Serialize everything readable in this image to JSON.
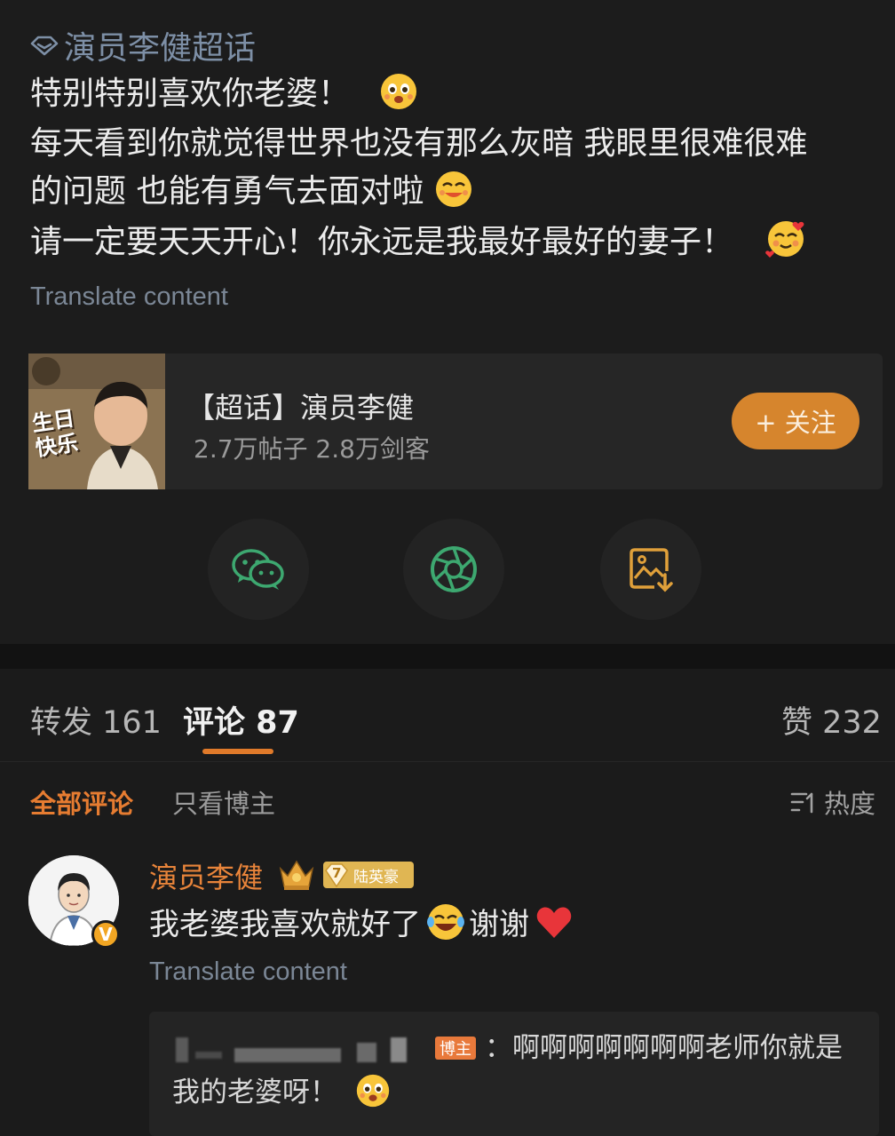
{
  "post": {
    "topic_tag": "演员李健超话",
    "lines": [
      "特别特别喜欢你老婆！",
      "每天看到你就觉得世界也没有那么灰暗 我眼里很难很难",
      "的问题 也能有勇气去面对啦",
      "请一定要天天开心！你永远是我最好最好的妻子！"
    ],
    "translate": "Translate content"
  },
  "topic_card": {
    "title": "【超话】演员李健",
    "subtitle": "2.7万帖子 2.8万剑客",
    "follow": "+ 关注",
    "thumb_text": [
      "生日",
      "快乐"
    ]
  },
  "stats": {
    "reposts": "转发 161",
    "comments": "评论 87",
    "likes": "赞 232"
  },
  "filters": {
    "all": "全部评论",
    "author_only": "只看博主",
    "sort": "热度"
  },
  "comment": {
    "name": "演员李健",
    "level_badge": "7",
    "badge_label": "陆英豪",
    "text_before": "我老婆我喜欢就好了",
    "text_after": "谢谢",
    "translate": "Translate content",
    "reply": {
      "author_tag": "博主",
      "text": "：啊啊啊啊啊啊啊老师你就是我的老婆呀！"
    }
  },
  "colors": {
    "accent_orange": "#e07a2a",
    "follow_button": "#d6852d",
    "link_gray": "#7b8796",
    "background": "#1b1b1b"
  }
}
